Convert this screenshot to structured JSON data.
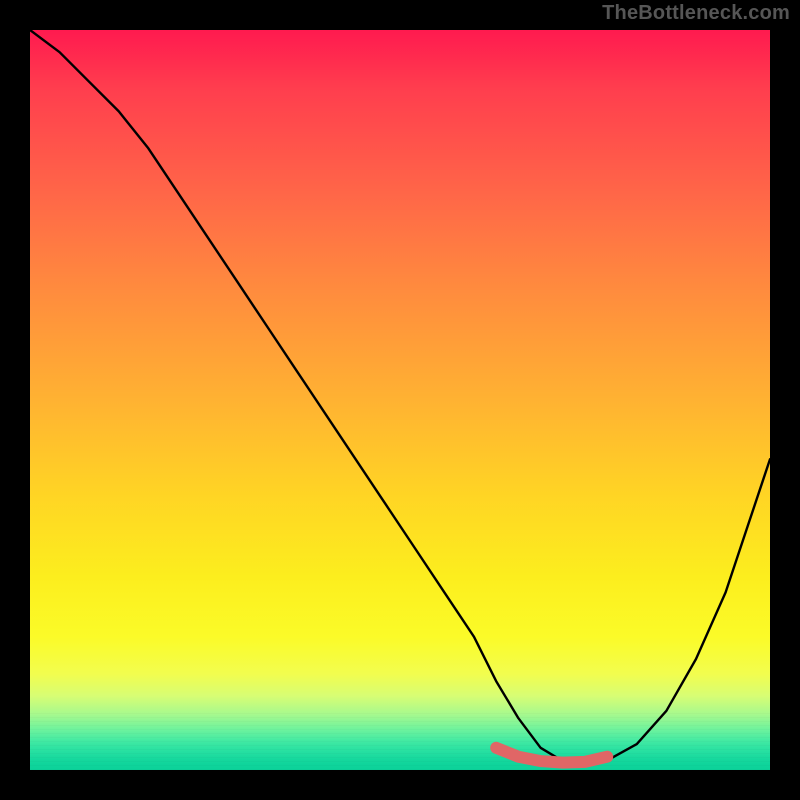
{
  "watermark": "TheBottleneck.com",
  "colors": {
    "background": "#000000",
    "curve": "#000000",
    "highlight": "#e06666"
  },
  "chart_data": {
    "type": "line",
    "title": "",
    "xlabel": "",
    "ylabel": "",
    "xlim": [
      0,
      100
    ],
    "ylim": [
      0,
      100
    ],
    "grid": false,
    "legend": false,
    "series": [
      {
        "name": "curve",
        "x": [
          0,
          4,
          8,
          12,
          16,
          20,
          24,
          28,
          32,
          36,
          40,
          44,
          48,
          52,
          56,
          60,
          63,
          66,
          69,
          72,
          75,
          78,
          82,
          86,
          90,
          94,
          97,
          100
        ],
        "y": [
          100,
          97,
          93,
          89,
          84,
          78,
          72,
          66,
          60,
          54,
          48,
          42,
          36,
          30,
          24,
          18,
          12,
          7,
          3,
          1.2,
          0.8,
          1.3,
          3.5,
          8,
          15,
          24,
          33,
          42
        ]
      }
    ],
    "highlight_segment": {
      "name": "optimal-range",
      "x": [
        63,
        66,
        69,
        72,
        75,
        78
      ],
      "y": [
        3.0,
        1.8,
        1.2,
        1.0,
        1.1,
        1.8
      ]
    },
    "gradient_stops": [
      {
        "pos": 0.0,
        "color": "#ff1a4f"
      },
      {
        "pos": 0.35,
        "color": "#ff8b3e"
      },
      {
        "pos": 0.63,
        "color": "#ffd524"
      },
      {
        "pos": 0.82,
        "color": "#fbfb28"
      },
      {
        "pos": 0.93,
        "color": "#a6f98e"
      },
      {
        "pos": 1.0,
        "color": "#0cd29a"
      }
    ]
  }
}
